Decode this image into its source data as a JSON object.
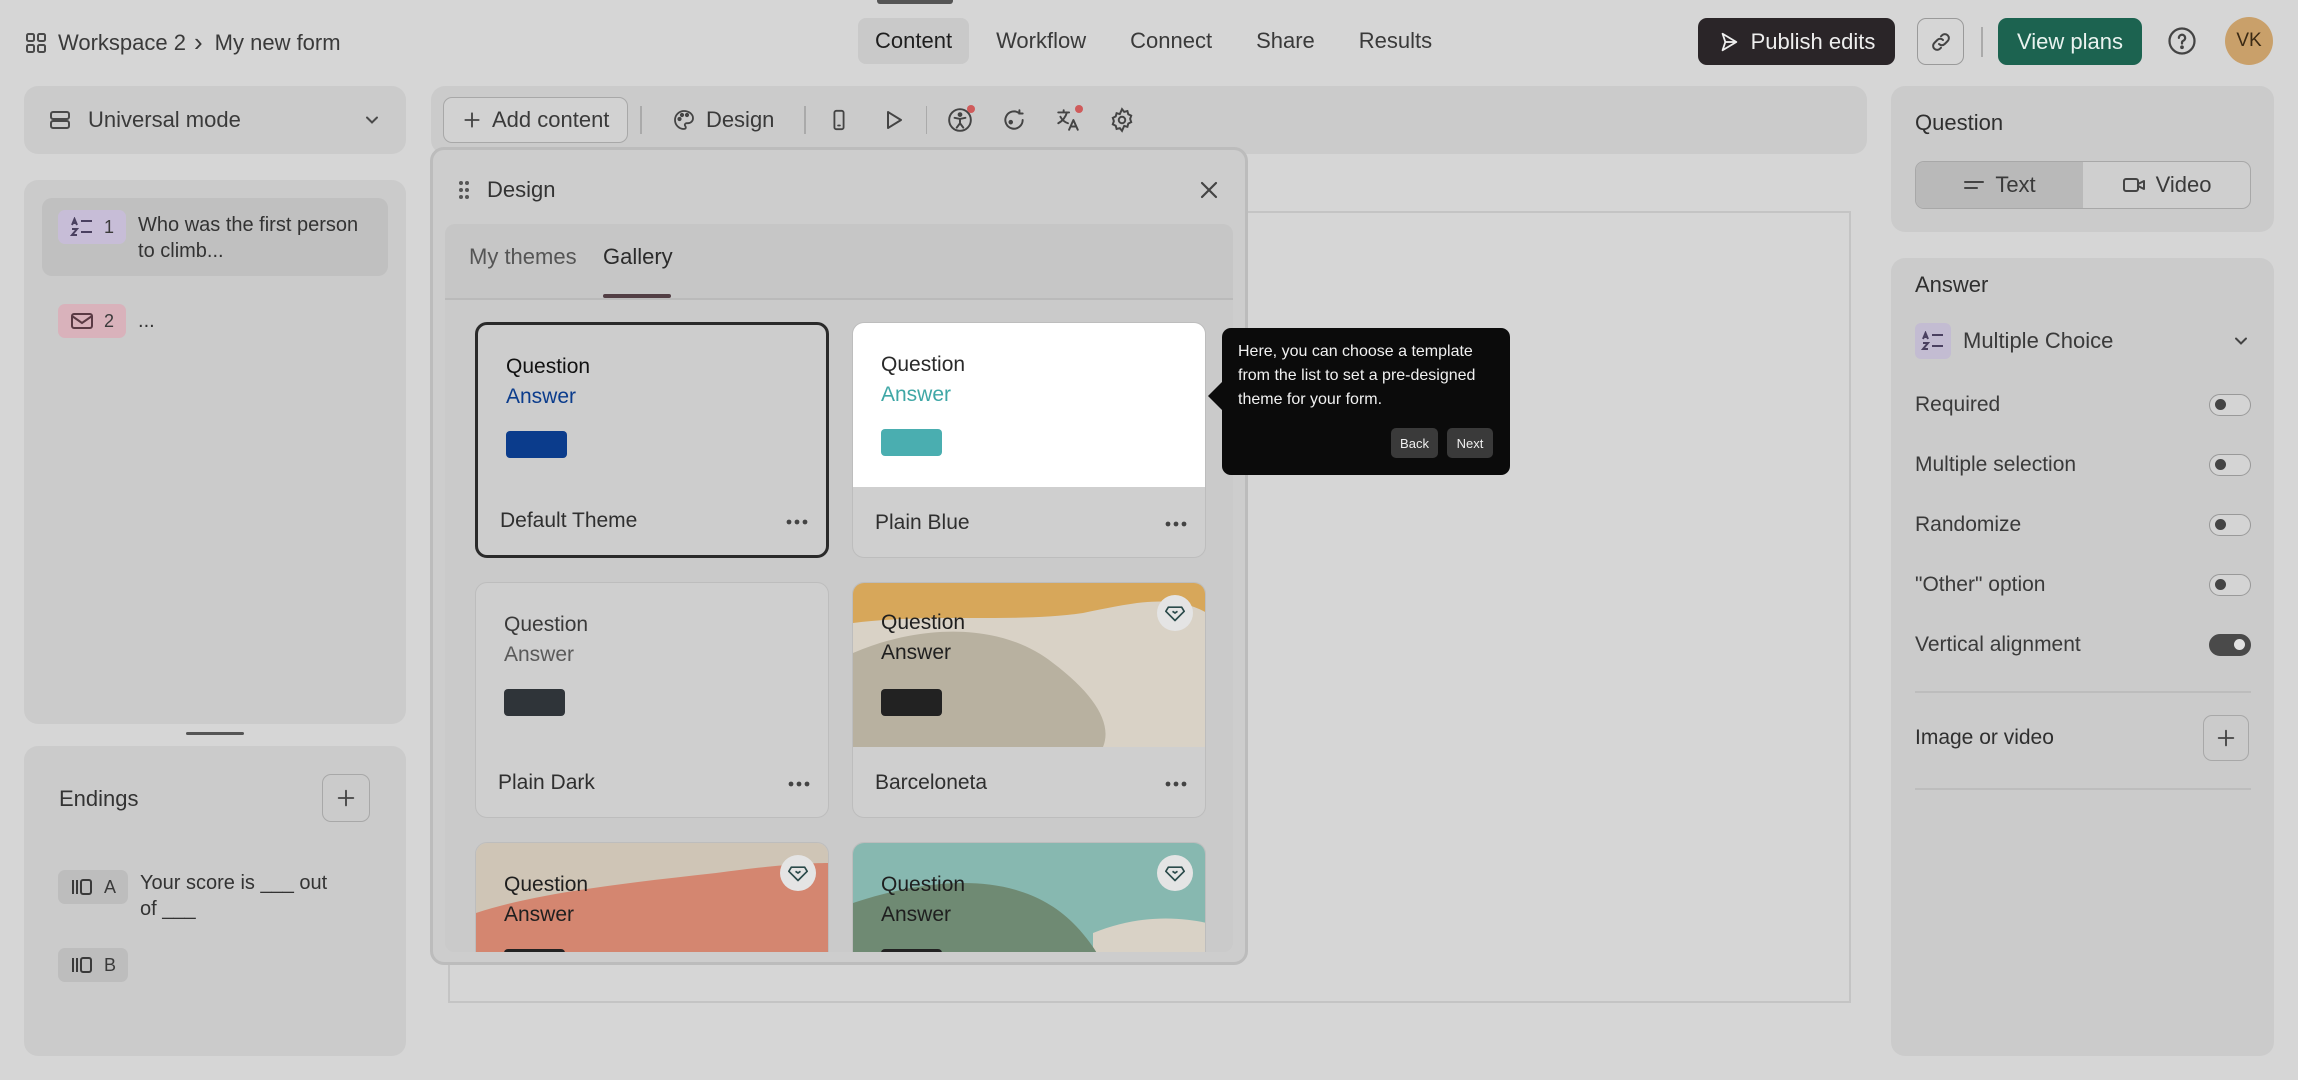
{
  "breadcrumb": {
    "workspace": "Workspace 2",
    "separator": "›",
    "form": "My new form"
  },
  "nav": {
    "tabs": [
      "Content",
      "Workflow",
      "Connect",
      "Share",
      "Results"
    ],
    "active": "Content"
  },
  "header": {
    "publish_label": "Publish edits",
    "view_plans_label": "View plans",
    "avatar_initials": "VK"
  },
  "left": {
    "mode_label": "Universal mode",
    "questions": [
      {
        "number": "1",
        "text": "Who was the first person to climb...",
        "type_icon": "multiple-choice-icon"
      },
      {
        "number": "2",
        "text": "...",
        "type_icon": "mail-icon"
      }
    ],
    "endings_title": "Endings",
    "endings": [
      {
        "letter": "A",
        "text": "Your score is ___ out of ___"
      },
      {
        "letter": "B",
        "text": ""
      }
    ]
  },
  "toolbar": {
    "add_content_label": "Add content",
    "design_label": "Design"
  },
  "design_dialog": {
    "title": "Design",
    "tabs": [
      "My themes",
      "Gallery"
    ],
    "active_tab": "Gallery",
    "themes": [
      {
        "name": "Default Theme",
        "question": "Question",
        "answer": "Answer",
        "question_color": "#111111",
        "answer_color": "#0b3c8c",
        "button_color": "#0b3c8c",
        "selected": true,
        "premium": false
      },
      {
        "name": "Plain Blue",
        "question": "Question",
        "answer": "Answer",
        "question_color": "#2a2a2a",
        "answer_color": "#3fa7a6",
        "button_color": "#4aaeb0",
        "selected": false,
        "premium": false
      },
      {
        "name": "Plain Dark",
        "question": "Question",
        "answer": "Answer",
        "question_color": "#3a3a3a",
        "answer_color": "#5a5a5a",
        "button_color": "#2f3439",
        "selected": false,
        "premium": false
      },
      {
        "name": "Barceloneta",
        "question": "Question",
        "answer": "Answer",
        "question_color": "#1f1f1f",
        "answer_color": "#1f1f1f",
        "button_color": "#222222",
        "selected": false,
        "premium": true
      },
      {
        "name": "",
        "question": "Question",
        "answer": "Answer",
        "question_color": "#1f1f1f",
        "answer_color": "#1f1f1f",
        "button_color": "#222222",
        "selected": false,
        "premium": true
      },
      {
        "name": "",
        "question": "Question",
        "answer": "Answer",
        "question_color": "#1f1f1f",
        "answer_color": "#1f1f1f",
        "button_color": "#222222",
        "selected": false,
        "premium": true
      }
    ]
  },
  "tooltip": {
    "text": "Here, you can choose a template from the list to set a pre-designed theme for your form.",
    "back_label": "Back",
    "next_label": "Next"
  },
  "right": {
    "question_title": "Question",
    "question_modes": [
      "Text",
      "Video"
    ],
    "active_mode": "Text",
    "answer_title": "Answer",
    "answer_type": "Multiple Choice",
    "options": [
      {
        "label": "Required",
        "on": false
      },
      {
        "label": "Multiple selection",
        "on": false
      },
      {
        "label": "Randomize",
        "on": false
      },
      {
        "label": "\"Other\" option",
        "on": false
      },
      {
        "label": "Vertical alignment",
        "on": true
      }
    ],
    "image_video_label": "Image or video"
  }
}
